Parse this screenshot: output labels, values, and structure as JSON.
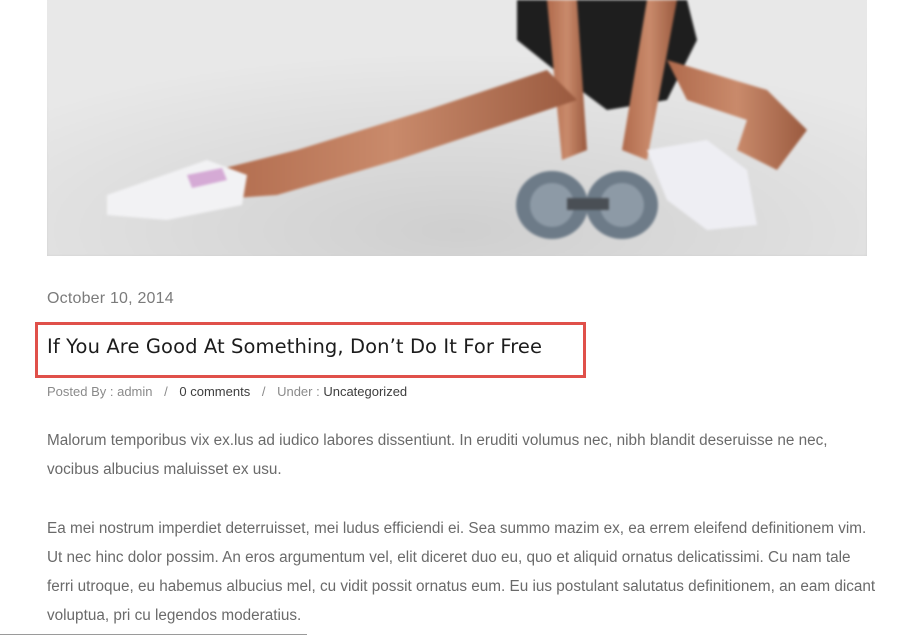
{
  "post": {
    "date": "October 10, 2014",
    "title": "If You Are Good At Something, Don’t Do It For Free",
    "meta": {
      "posted_by_label": "Posted By : ",
      "author": "admin",
      "separator": "/",
      "comments_link": "0 comments",
      "under_label": "Under : ",
      "category_link": "Uncategorized"
    },
    "paragraphs": [
      "Malorum temporibus vix ex.lus ad iudico labores dissentiunt. In eruditi volumus nec, nibh blandit deseruisse ne nec, vocibus albucius maluisset ex usu.",
      "Ea mei nostrum imperdiet deterruisset, mei ludus efficiendi ei. Sea summo mazim ex, ea errem eleifend definitionem vim. Ut nec hinc dolor possim. An eros argumentum vel, elit diceret duo eu, quo et aliquid ornatus delicatissimi. Cu nam tale ferri utroque, eu habemus albucius mel, cu vidit possit ornatus eum. Eu ius postulant salutatus definitionem, an eam dicant voluptua, pri cu legendos moderatius."
    ]
  },
  "colors": {
    "title_highlight_border": "#e0504a",
    "title_text": "#1c1c1c",
    "body_text": "#6a6a6a",
    "meta_text": "#8a8a8a",
    "link_text": "#3d3d3d"
  },
  "icons": {
    "featured_image": "fitness-woman-dumbbells-photo"
  }
}
